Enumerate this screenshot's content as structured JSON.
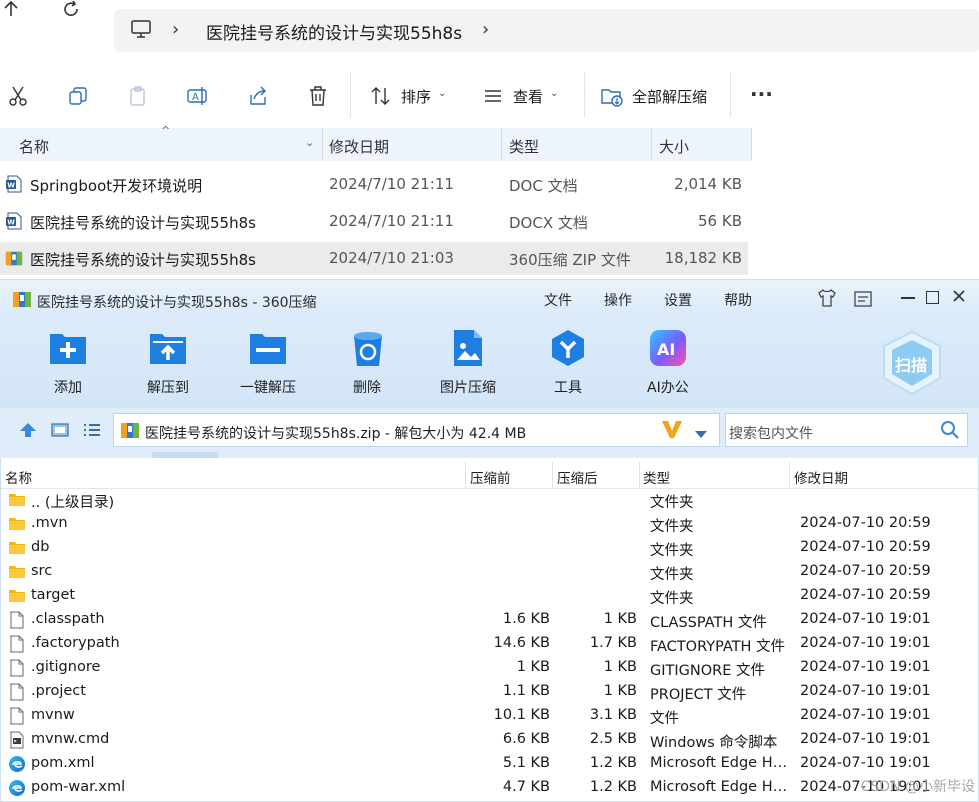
{
  "explorer": {
    "address": {
      "path": "医院挂号系统的设计与实现55h8s"
    },
    "toolbar": {
      "sort_label": "排序",
      "view_label": "查看",
      "extract_all_label": "全部解压缩",
      "more_label": "···"
    },
    "columns": {
      "name": "名称",
      "date": "修改日期",
      "type": "类型",
      "size": "大小"
    },
    "files": [
      {
        "name": "Springboot开发环境说明",
        "date": "2024/7/10 21:11",
        "type": "DOC 文档",
        "size": "2,014 KB",
        "icon": "word-doc-icon"
      },
      {
        "name": "医院挂号系统的设计与实现55h8s",
        "date": "2024/7/10 21:11",
        "type": "DOCX 文档",
        "size": "56 KB",
        "icon": "word-doc-icon"
      },
      {
        "name": "医院挂号系统的设计与实现55h8s",
        "date": "2024/7/10 21:03",
        "type": "360压缩 ZIP 文件",
        "size": "18,182 KB",
        "icon": "zip-archive-icon",
        "selected": true
      }
    ]
  },
  "zip360": {
    "title": "医院挂号系统的设计与实现55h8s - 360压缩",
    "menu": [
      "文件",
      "操作",
      "设置",
      "帮助"
    ],
    "tools": [
      {
        "label": "添加",
        "icon": "add-icon"
      },
      {
        "label": "解压到",
        "icon": "extract-to-icon"
      },
      {
        "label": "一键解压",
        "icon": "one-click-extract-icon"
      },
      {
        "label": "删除",
        "icon": "delete-icon"
      },
      {
        "label": "图片压缩",
        "icon": "image-compress-icon"
      },
      {
        "label": "工具",
        "icon": "tools-icon"
      },
      {
        "label": "AI办公",
        "icon": "ai-office-icon"
      }
    ],
    "scan_label": "扫描",
    "path_text": "医院挂号系统的设计与实现55h8s.zip - 解包大小为 42.4 MB",
    "search_placeholder": "搜索包内文件",
    "columns": {
      "name": "名称",
      "before": "压缩前",
      "after": "压缩后",
      "type": "类型",
      "date": "修改日期"
    },
    "entries": [
      {
        "name": ".. (上级目录)",
        "before": "",
        "after": "",
        "type": "文件夹",
        "date": "",
        "icon": "folder-icon"
      },
      {
        "name": ".mvn",
        "before": "",
        "after": "",
        "type": "文件夹",
        "date": "2024-07-10 20:59",
        "icon": "folder-icon"
      },
      {
        "name": "db",
        "before": "",
        "after": "",
        "type": "文件夹",
        "date": "2024-07-10 20:59",
        "icon": "folder-icon"
      },
      {
        "name": "src",
        "before": "",
        "after": "",
        "type": "文件夹",
        "date": "2024-07-10 20:59",
        "icon": "folder-icon"
      },
      {
        "name": "target",
        "before": "",
        "after": "",
        "type": "文件夹",
        "date": "2024-07-10 20:59",
        "icon": "folder-icon"
      },
      {
        "name": ".classpath",
        "before": "1.6 KB",
        "after": "1 KB",
        "type": "CLASSPATH 文件",
        "date": "2024-07-10 19:01",
        "icon": "file-icon"
      },
      {
        "name": ".factorypath",
        "before": "14.6 KB",
        "after": "1.7 KB",
        "type": "FACTORYPATH 文件",
        "date": "2024-07-10 19:01",
        "icon": "file-icon"
      },
      {
        "name": ".gitignore",
        "before": "1 KB",
        "after": "1 KB",
        "type": "GITIGNORE 文件",
        "date": "2024-07-10 19:01",
        "icon": "file-icon"
      },
      {
        "name": ".project",
        "before": "1.1 KB",
        "after": "1 KB",
        "type": "PROJECT 文件",
        "date": "2024-07-10 19:01",
        "icon": "file-icon"
      },
      {
        "name": "mvnw",
        "before": "10.1 KB",
        "after": "3.1 KB",
        "type": "文件",
        "date": "2024-07-10 19:01",
        "icon": "file-icon"
      },
      {
        "name": "mvnw.cmd",
        "before": "6.6 KB",
        "after": "2.5 KB",
        "type": "Windows 命令脚本",
        "date": "2024-07-10 19:01",
        "icon": "cmd-script-icon"
      },
      {
        "name": "pom.xml",
        "before": "5.1 KB",
        "after": "1.2 KB",
        "type": "Microsoft Edge HT...",
        "date": "2024-07-10 19:01",
        "icon": "edge-icon"
      },
      {
        "name": "pom-war.xml",
        "before": "4.7 KB",
        "after": "1.2 KB",
        "type": "Microsoft Edge HT...",
        "date": "2024-07-10 19:01",
        "icon": "edge-icon"
      }
    ]
  },
  "watermark": "CSDN @小新毕设"
}
